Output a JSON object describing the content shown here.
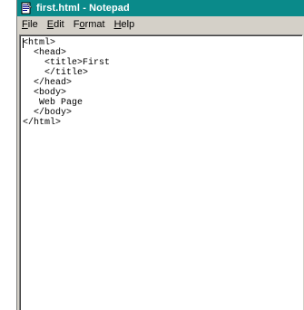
{
  "window": {
    "title": "first.html - Notepad",
    "icon": "notepad-icon"
  },
  "menubar": {
    "items": [
      {
        "pre": "",
        "accel": "F",
        "post": "ile"
      },
      {
        "pre": "",
        "accel": "E",
        "post": "dit"
      },
      {
        "pre": "F",
        "accel": "o",
        "post": "rmat"
      },
      {
        "pre": "",
        "accel": "H",
        "post": "elp"
      }
    ]
  },
  "editor": {
    "content": "<html>\n  <head>\n    <title>First\n    </title>\n  </head>\n  <body>\n   Web Page\n  </body>\n</html>"
  },
  "colors": {
    "titlebar": "#0a8a8a",
    "chrome": "#d4d0c8",
    "editor_bg": "#ffffff"
  }
}
